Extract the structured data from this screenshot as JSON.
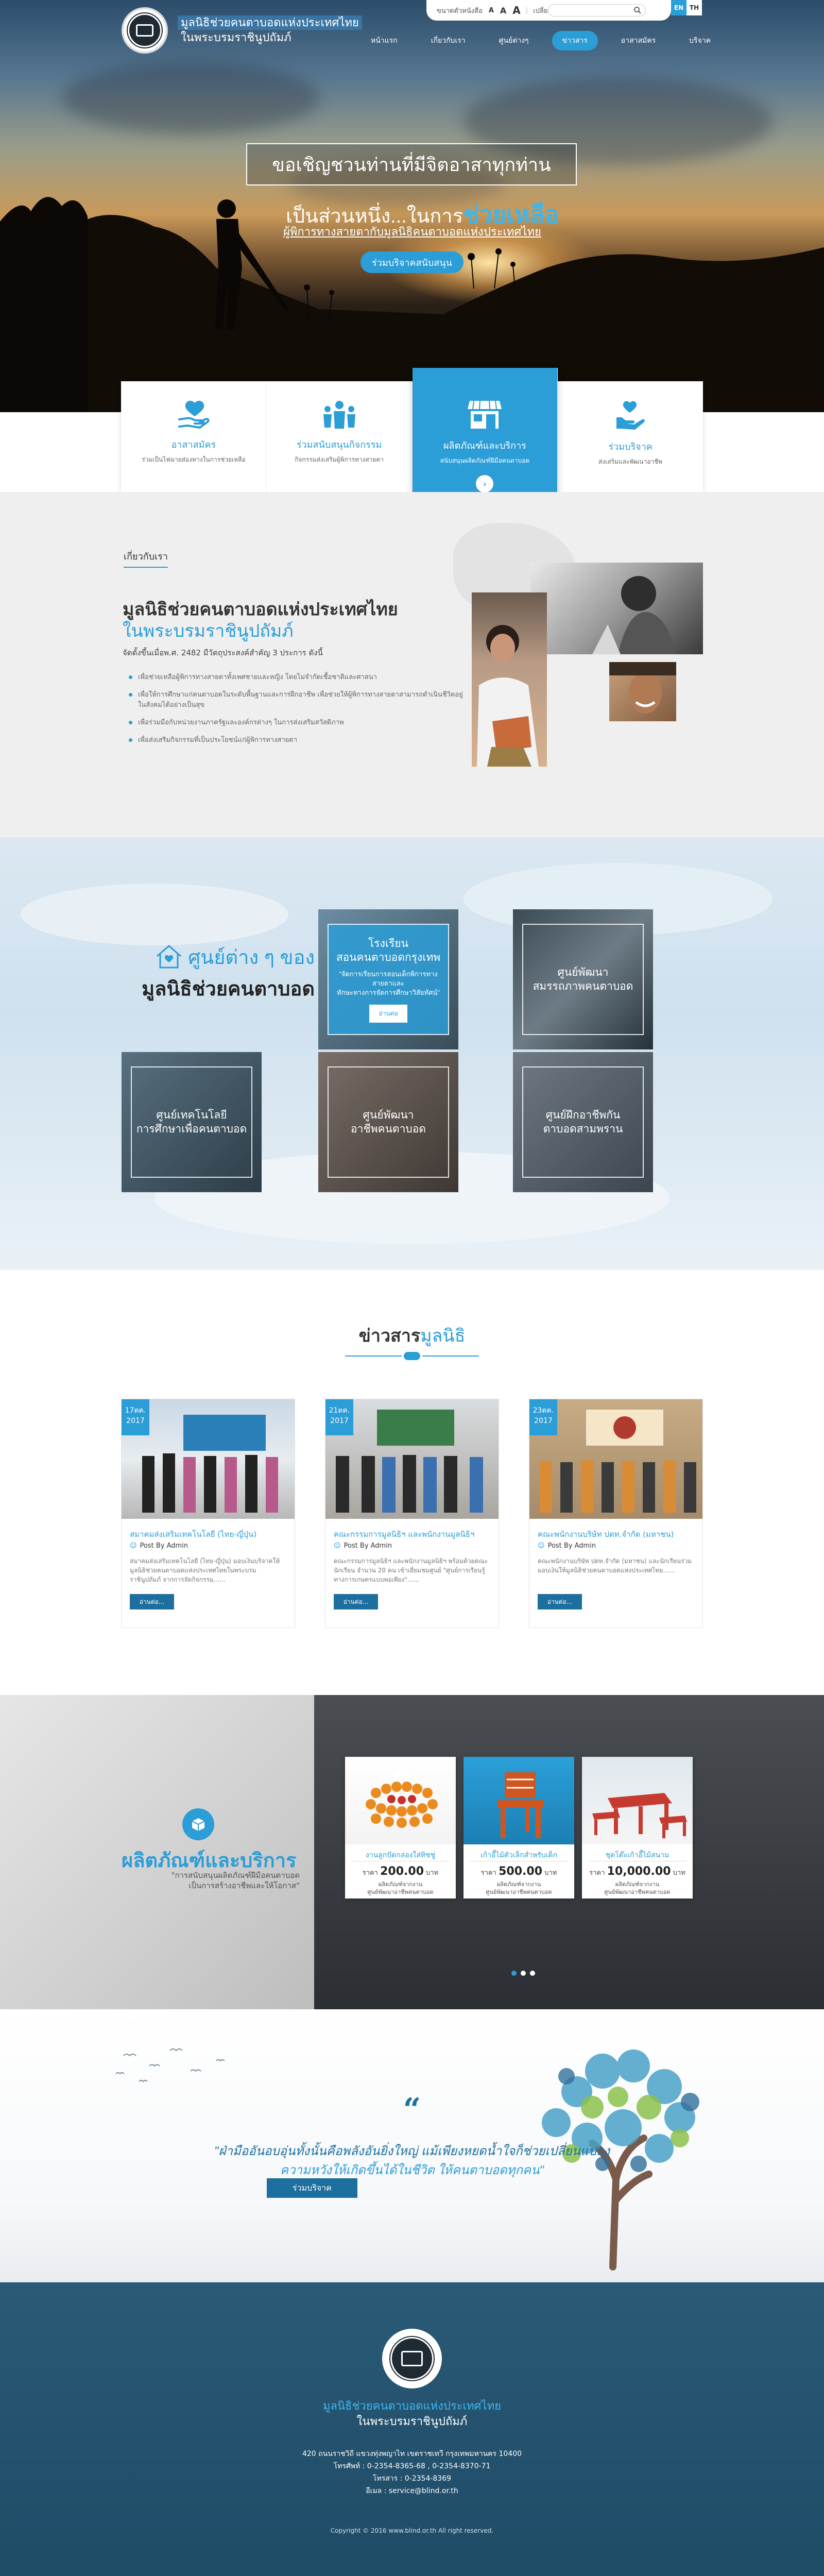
{
  "header": {
    "brand_line1": "มูลนิธิช่วยคนตาบอดแห่งประเทศไทย",
    "brand_line2": "ในพระบรมราชินูปถัมภ์",
    "font_size_label": "ขนาดตัวหนังสือ",
    "font_sizes": [
      "A",
      "A",
      "A"
    ],
    "contrast_label": "เปลี่ยนสี",
    "color_options": [
      "AA",
      "AA",
      "AA"
    ],
    "search_placeholder": "",
    "lang_en": "EN",
    "lang_th": "TH",
    "nav": [
      "หน้าแรก",
      "เกี่ยวกับเรา",
      "ศูนย์ต่างๆ",
      "ข่าวสาร",
      "อาสาสมัคร",
      "บริจาค"
    ],
    "nav_active": 3
  },
  "hero": {
    "line1": "ขอเชิญชวนท่านที่มีจิตอาสาทุกท่าน",
    "line2_prefix": "เป็นส่วนหนึ่ง...ในการ",
    "line2_highlight": "ช่วยเหลือ",
    "line3": "ผู้พิการทางสายตากับมูลนิธิคนตาบอดแห่งประเทศไทย",
    "cta": "ร่วมบริจาคสนับสนุน"
  },
  "features": [
    {
      "icon": "heart-hand-icon",
      "title": "อาสาสมัคร",
      "desc": "ร่วมเป็นไฟฉายส่องทางในการช่วยเหลือ"
    },
    {
      "icon": "people-icon",
      "title": "ร่วมสนับสนุนกิจกรรม",
      "desc": "กิจกรรมส่งเสริมผู้พิการทางสายตา"
    },
    {
      "icon": "store-icon",
      "title": "ผลิตภัณฑ์และบริการ",
      "desc": "สนับสนุนผลิตภัณฑ์ฝีมือคนตาบอด",
      "arrow": "›"
    },
    {
      "icon": "donate-icon",
      "title": "ร่วมบริจาค",
      "desc": "ส่งเสริมและพัฒนาอาชีพ"
    }
  ],
  "about": {
    "label": "เกี่ยวกับเรา",
    "title1": "มูลนิธิช่วยคนตาบอดแห่งประเทศไทย",
    "title2": "ในพระบรมราชินูปถัมภ์",
    "founded": "จัดตั้งขึ้นเมื่อพ.ศ. 2482 มีวัตถุประสงค์สำคัญ 3 ประการ ดังนี้",
    "items": [
      "เพื่อช่วยเหลือผู้พิการทางสายตาทั้งเพศชายและหญิง โดยไม่จำกัดเชื้อชาติและศาสนา",
      "เพื่อให้การศึกษาแก่คนตาบอดในระดับพื้นฐานและการฝึกอาชีพ เพื่อช่วยให้ผู้พิการทางสายตาสามารถดำเนินชีวิตอยู่ในสังคมได้อย่างเป็นสุข",
      "เพื่อร่วมมือกับหน่วยงานภาครัฐและองค์กรต่างๆ ในการส่งเสริมสวัสดิภาพ",
      "เพื่อส่งเสริมกิจกรรมที่เป็นประโยชน์แก่ผู้พิการทางสายตา"
    ]
  },
  "centers": {
    "title_a": "ศูนย์ต่าง ๆ ของ",
    "title_b": "มูลนิธิช่วยคนตาบอด",
    "items": [
      {
        "name": "โรงเรียน\nสอนคนตาบอดกรุงเทพ",
        "desc": "\"จัดการเรียนการสอนเด็กพิการทางสายตาและ\nทักษะทางการจัดการศึกษาวิสัยทัศน์\"",
        "btn": "อ่านต่อ"
      },
      {
        "name": "ศูนย์พัฒนา\nสมรรถภาพคนตาบอด"
      },
      {
        "name": "ศูนย์เทคโนโลยี\nการศึกษาเพื่อคนตาบอด"
      },
      {
        "name": "ศูนย์พัฒนา\nอาชีพคนตาบอด"
      },
      {
        "name": "ศูนย์ฝึกอาชีพกัน\nตาบอดสามพราน"
      }
    ]
  },
  "news": {
    "title_a": "ข่าวสาร",
    "title_b": "มูลนิธิ",
    "items": [
      {
        "day": "17ตค.",
        "year": "2017",
        "title": "สมาคมส่งเสริมเทคโนโลยี (ไทย-ญี่ปุ่น)",
        "by": "Post By Admin",
        "excerpt": "สมาคมส่งเสริมเทคโนโลยี (ไทย-ญี่ปุ่น) มอบเงินบริจาคให้มูลนิธิช่วยคนตาบอดแห่งประเทศไทยในพระบรมราชินูปถัมภ์ จากการจัดกิจกรรม......",
        "more": "อ่านต่อ..."
      },
      {
        "day": "21ตค.",
        "year": "2017",
        "title": "คณะกรรมการมูลนิธิฯ และพนักงานมูลนิธิฯ",
        "by": "Post By Admin",
        "excerpt": "คณะกรรมการมูลนิธิฯ และพนักงานมูลนิธิฯ พร้อมด้วยคณะนักเรียน จำนวน 20 คน เข้าเยี่ยมชมศูนย์ \"ศูนย์การเรียนรู้ทางการเกษตรแบบพอเพียง\"......",
        "more": "อ่านต่อ..."
      },
      {
        "day": "23ตค.",
        "year": "2017",
        "title": "คณะพนักงานบริษัท ปตท.จำกัด (มหาชน)",
        "by": "Post By Admin",
        "excerpt": "คณะพนักงานบริษัท ปตท.จำกัด (มหาชน) และนักเรียนร่วมมอบเงินให้มูลนิธิช่วยคนตาบอดแห่งประเทศไทย......",
        "more": "อ่านต่อ..."
      }
    ]
  },
  "products": {
    "title": "ผลิตภัณฑ์และบริการ",
    "desc": "\"การสนับสนุนผลิตภัณฑ์ฝีมือคนตาบอด\nเป็นการสร้างอาชีพและให้โอกาส\"",
    "items": [
      {
        "name": "งานลูกปัดกล่องใส่ทิชชู่",
        "price_label": "ราคา",
        "price": "200.00",
        "unit": "บาท",
        "by": "ผลิตภัณฑ์จากงาน\nศูนย์พัฒนาอาชีพคนตาบอด"
      },
      {
        "name": "เก้าอี้ไม้ตัวเล็กสำหรับเด็ก",
        "price_label": "ราคา",
        "price": "500.00",
        "unit": "บาท",
        "by": "ผลิตภัณฑ์จากงาน\nศูนย์พัฒนาอาชีพคนตาบอด"
      },
      {
        "name": "ชุดโต๊ะเก้าอี้ไม้สนาม",
        "price_label": "ราคา",
        "price": "10,000.00",
        "unit": "บาท",
        "by": "ผลิตภัณฑ์จากงาน\nศูนย์พัฒนาอาชีพคนตาบอด"
      }
    ],
    "slides": 3,
    "active_slide": 0
  },
  "quote": {
    "mark": "“",
    "line1": "\"ฝ่ามืออันอบอุ่นทั้งนั้นคือพลังอันยิ่งใหญ่ แม้เพียงหยดน้ำใจก็ช่วยเปลี่ยนแปลง",
    "line2": "ความหวังให้เกิดขึ้นได้ในชีวิต ให้คนตาบอดทุกคน\"",
    "cta": "ร่วมบริจาค"
  },
  "footer": {
    "title1": "มูลนิธิช่วยคนตาบอดแห่งประเทศไทย",
    "title2": "ในพระบรมราชินูปถัมภ์",
    "address": "420 ถนนราชวิถี แขวงทุ่งพญาไท เขตราชเทวี กรุงเทพมหานคร 10400",
    "phone": "โทรศัพท์ : 0-2354-8365-68 , 0-2354-8370-71",
    "fax": "โทรสาร : 0-2354-8369",
    "email": "อีเมล : service@blind.or.th",
    "copyright": "Copyright © 2016 www.blind.or.th All right reserved."
  },
  "colors": {
    "accent": "#2b9dd7",
    "dark_accent": "#1d6f9f",
    "footer": "#1f4b66"
  }
}
